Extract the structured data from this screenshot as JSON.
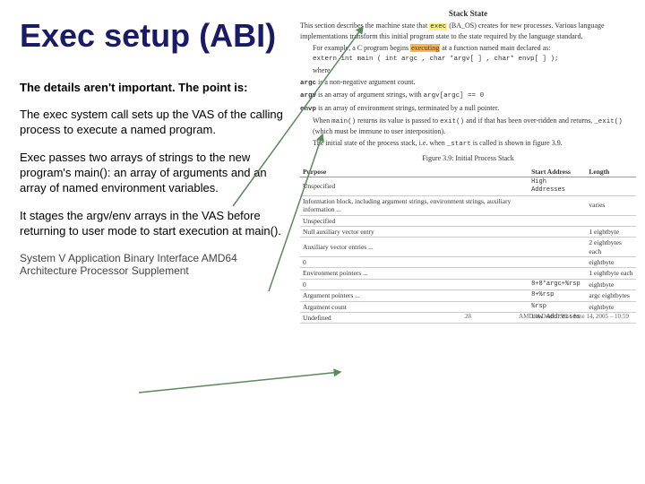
{
  "title": "Exec setup (ABI)",
  "left": {
    "p1": "The details aren't important. The point is:",
    "p2": "The exec system call sets up the VAS of the calling process to execute a named program.",
    "p3": "Exec passes two arrays of strings to the new program's main(): an array of arguments and an array of named environment variables.",
    "p4": "It stages the argv/env arrays in the VAS before returning to user mode to start execution at main().",
    "caption": "System V Application Binary Interface AMD64 Architecture Processor Supplement"
  },
  "right": {
    "section_title": "Stack State",
    "intro1a": "This section describes the machine state that ",
    "intro1_hl": "exec",
    "intro1b": " (BA_OS) creates for new processes. Various language implementations transform this initial program state to the state required by the language standard.",
    "intro2a": "For example, a C program begins ",
    "intro2_hl": "executing",
    "intro2b": " at a function named main declared as:",
    "code_decl": "extern int main ( int argc , char *argv[ ] , char* envp[ ] );",
    "where": "where",
    "argc_desc": " is a non-negative argument count.",
    "argv_desc_a": " is an array of argument strings, with ",
    "argv_desc_code": "argv[argc] == 0",
    "envp_desc": " is an array of environment strings, terminated by a null pointer.",
    "main_ret1": "When ",
    "main_ret1_code": "main()",
    "main_ret2": " returns its value is passed to ",
    "main_ret2_code": "exit()",
    "main_ret3": " and if that has been over-ridden and returns, ",
    "main_ret3_code": "_exit()",
    "main_ret4": " (which must be immune to user interposition).",
    "initial_state_a": "The initial state of the process stack, i.e. when ",
    "initial_state_code": "_start",
    "initial_state_b": " is called is shown in figure 3.9.",
    "fig_caption": "Figure 3.9: Initial Process Stack",
    "table": {
      "headers": [
        "Purpose",
        "Start Address",
        "Length"
      ],
      "rows": [
        [
          "Unspecified",
          "High Addresses",
          ""
        ],
        [
          "Information block, including argument strings, environment strings, auxiliary information ...",
          "",
          "varies"
        ],
        [
          "Unspecified",
          "",
          ""
        ],
        [
          "Null auxiliary vector entry",
          "",
          "1 eightbyte"
        ],
        [
          "Auxiliary vector entries ...",
          "",
          "2 eightbytes each"
        ],
        [
          "0",
          "",
          "eightbyte"
        ],
        [
          "Environment pointers ...",
          "",
          "1 eightbyte each"
        ],
        [
          "0",
          "8+8*argc+%rsp",
          "eightbyte"
        ],
        [
          "Argument pointers ...",
          "8+%rsp",
          "argc eightbytes"
        ],
        [
          "Argument count",
          "%rsp",
          "eightbyte"
        ],
        [
          "Undefined",
          "Low Addresses",
          ""
        ]
      ]
    },
    "page_num": "28",
    "draft": "AMD64 Draft 0.96 – June 14, 2005 – 10:59"
  }
}
